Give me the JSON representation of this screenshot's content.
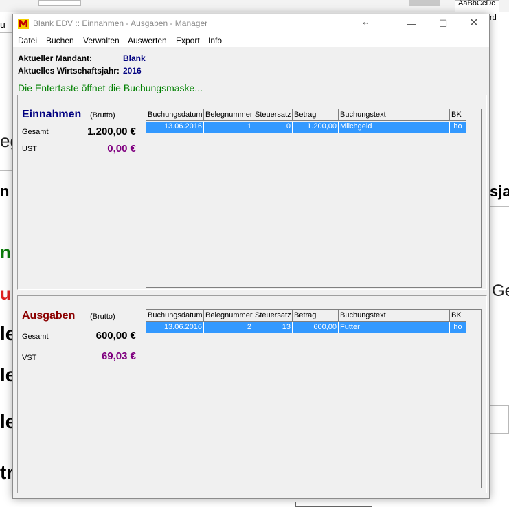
{
  "window": {
    "title": "Blank EDV :: Einnahmen - Ausgaben - Manager",
    "resize_glyph": "↔",
    "min_glyph": "—",
    "max_glyph": "☐",
    "close_glyph": "✕"
  },
  "menu": [
    "Datei",
    "Buchen",
    "Verwalten",
    "Auswerten",
    "Export",
    "Info"
  ],
  "info": {
    "mandant_label": "Aktueller Mandant:",
    "mandant_value": "Blank",
    "jahr_label": "Aktuelles Wirtschaftsjahr:",
    "jahr_value": "2016",
    "hint": "Die Entertaste öffnet die Buchungsmaske..."
  },
  "einnahmen": {
    "title": "Einnahmen",
    "brutto": "(Brutto)",
    "gesamt_label": "Gesamt",
    "gesamt_value": "1.200,00 €",
    "ust_label": "UST",
    "ust_value": "0,00 €",
    "headers": [
      "Buchungsdatum",
      "Belegnummer",
      "Steuersatz",
      "Betrag",
      "Buchungstext",
      "BK"
    ],
    "rows": [
      [
        "13.06.2016",
        "1",
        "0",
        "1.200,00",
        "Milchgeld",
        "ho"
      ]
    ]
  },
  "ausgaben": {
    "title": "Ausgaben",
    "brutto": "(Brutto)",
    "gesamt_label": "Gesamt",
    "gesamt_value": "600,00 €",
    "vst_label": "VST",
    "vst_value": "69,03 €",
    "headers": [
      "Buchungsdatum",
      "Belegnummer",
      "Steuersatz",
      "Betrag",
      "Buchungstext",
      "BK"
    ],
    "rows": [
      [
        "13.06.2016",
        "2",
        "13",
        "600,00",
        "Futter",
        "ho"
      ]
    ]
  },
  "background": {
    "style_gallery": "AaBbCcDc",
    "frag_u": "u",
    "frag_rd": "rd",
    "frag_eg": "eg",
    "frag_n": "n",
    "frag_sja": "sja",
    "frag_nn": "nn",
    "frag_us": "us",
    "frag_ge": "Ge",
    "frag_le1": "le",
    "frag_le2": "le",
    "frag_le3": "le",
    "frag_tr": "tr",
    "colors": {
      "accent_green": "#008000",
      "title_blue": "#000080",
      "expense_red": "#8b0000",
      "amount_purple": "#800080",
      "selection": "#3399ff"
    }
  }
}
